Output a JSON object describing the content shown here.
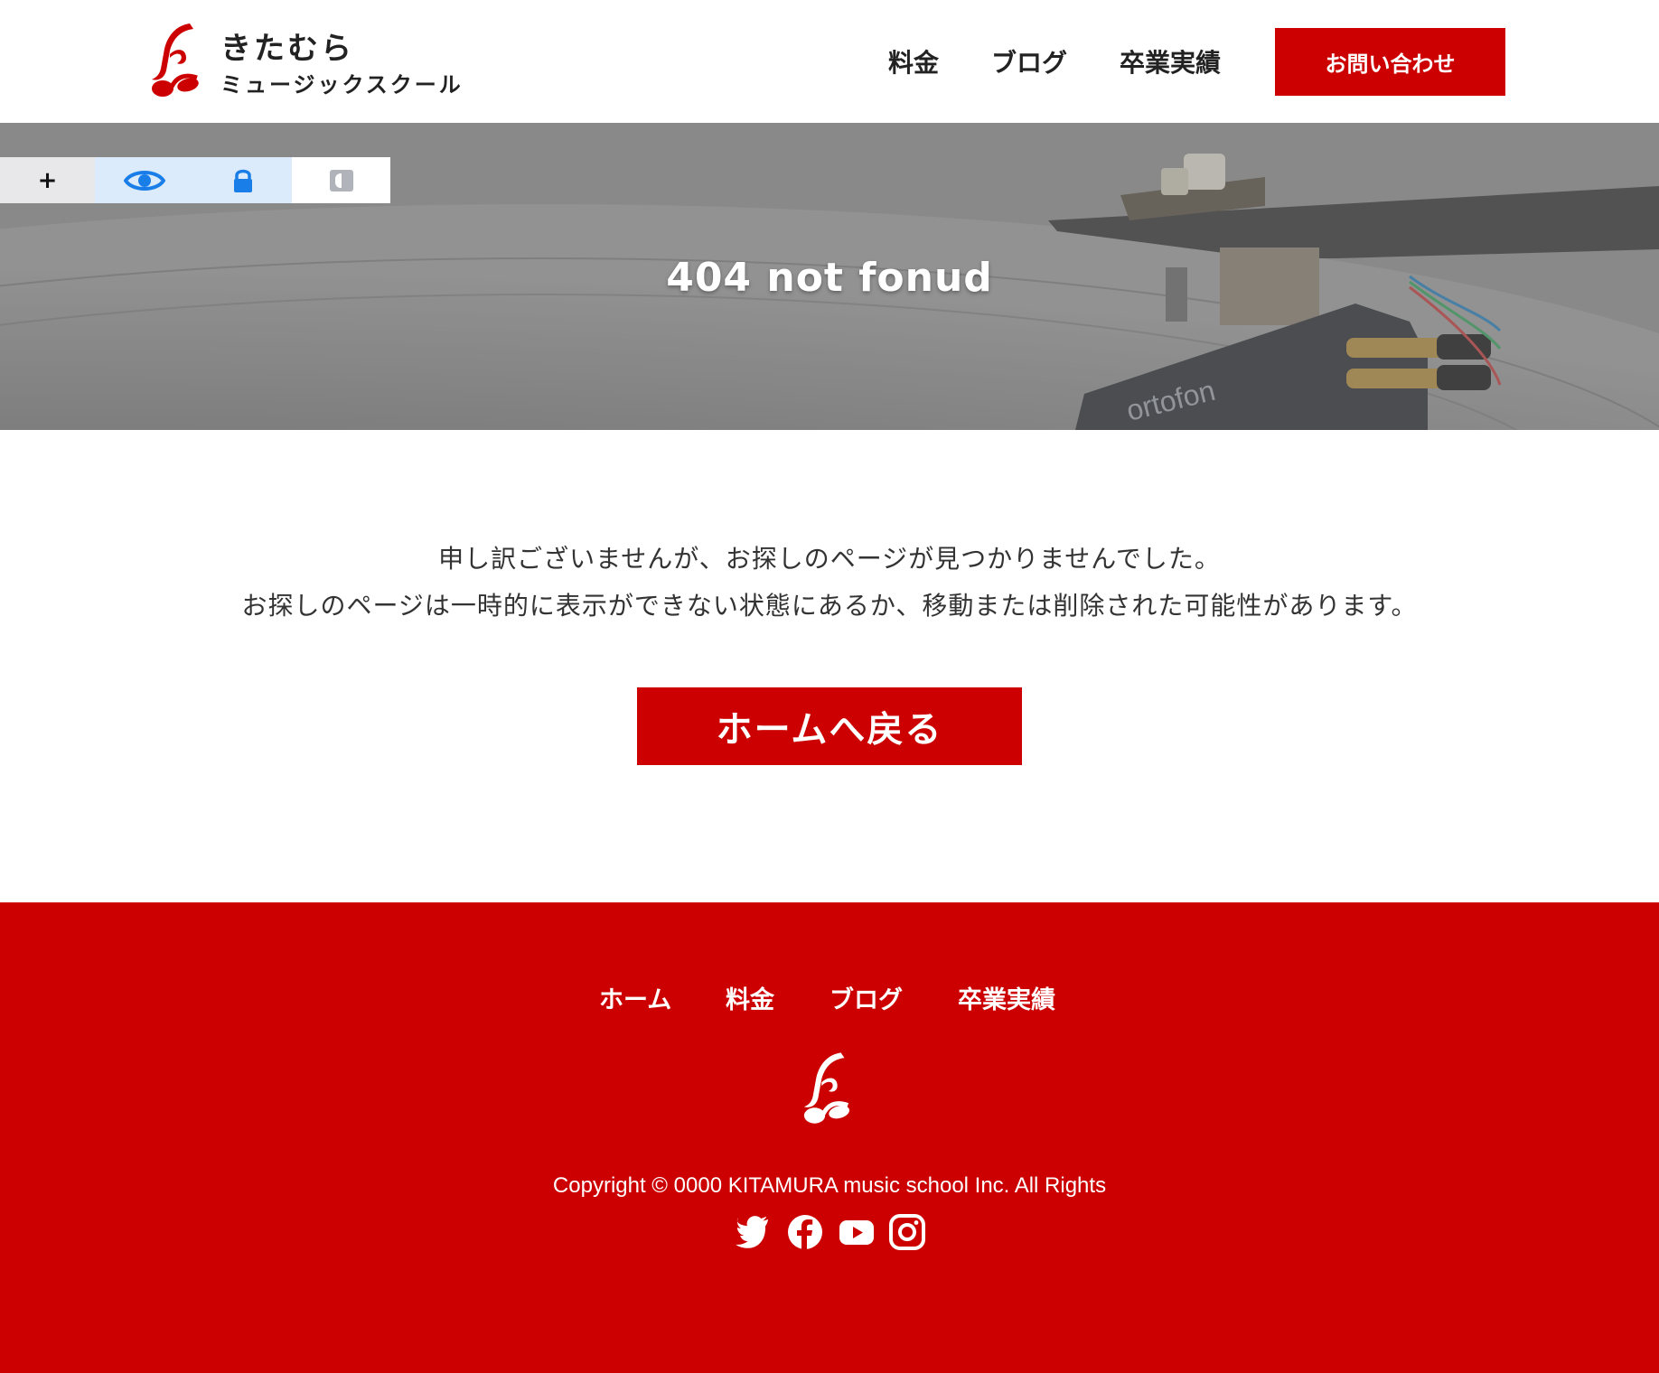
{
  "header": {
    "logo_name_1": "きたむら",
    "logo_name_2": "ミュージックスクール",
    "nav": [
      "料金",
      "ブログ",
      "卒業実績"
    ],
    "contact_label": "お問い合わせ"
  },
  "hero": {
    "title": "404 not fonud",
    "photo_label": "ortofon"
  },
  "toolbar": {
    "add_label": "+",
    "icons": [
      "eye-icon",
      "lock-icon",
      "contrast-icon"
    ]
  },
  "main": {
    "message_1": "申し訳ございませんが、お探しのページが見つかりませんでした。",
    "message_2": "お探しのページは一時的に表示ができない状態にあるか、移動または削除された可能性があります。",
    "home_button": "ホームへ戻る"
  },
  "footer": {
    "nav": [
      "ホーム",
      "料金",
      "ブログ",
      "卒業実績"
    ],
    "copyright": "Copyright © 0000 KITAMURA music school Inc. All Rights",
    "social": [
      "twitter-icon",
      "facebook-icon",
      "youtube-icon",
      "instagram-icon"
    ]
  },
  "colors": {
    "brand_red": "#cc0000",
    "toolbar_blue": "#1a7ee8"
  }
}
